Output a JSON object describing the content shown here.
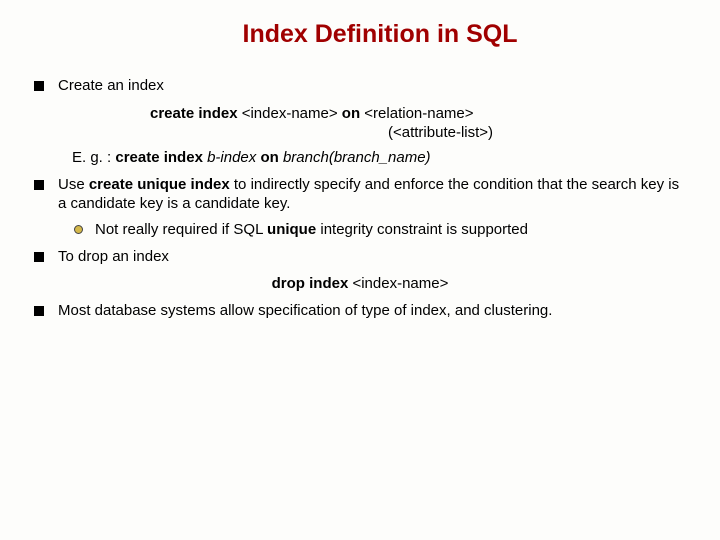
{
  "title": "Index Definition in SQL",
  "bullet1": "Create an index",
  "syntax_line1_pre": "create index ",
  "syntax_line1_arg1": "<index-name>",
  "syntax_line1_mid": " on ",
  "syntax_line1_arg2": "<relation-name>",
  "syntax_line2": "(<attribute-list>)",
  "eg_label": "E. g. : ",
  "eg_cmd": " create index ",
  "eg_rest": " b-index",
  "eg_on": " on ",
  "eg_tail": "branch(branch_name)",
  "bullet2_pre": "Use ",
  "bullet2_bold": "create unique index",
  "bullet2_post": " to indirectly specify and enforce the condition that the search key is a candidate key is a candidate key.",
  "sub_a_pre": "Not really required if SQL ",
  "sub_a_bold": "unique",
  "sub_a_post": " integrity constraint is supported",
  "bullet3": "To drop an index",
  "drop_cmd": "drop index ",
  "drop_arg": "<index-name>",
  "bullet4": "Most database systems allow specification of type of index, and clustering."
}
